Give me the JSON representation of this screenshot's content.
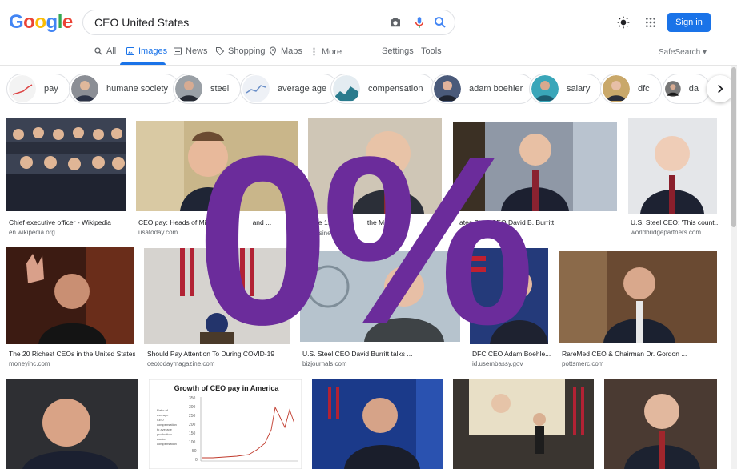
{
  "logo": "Google",
  "search": {
    "query": "CEO United States"
  },
  "tabs": [
    {
      "label": "All"
    },
    {
      "label": "Images"
    },
    {
      "label": "News"
    },
    {
      "label": "Shopping"
    },
    {
      "label": "Maps"
    },
    {
      "label": "More"
    }
  ],
  "tools": {
    "settings": "Settings",
    "tools": "Tools",
    "safesearch": "SafeSearch"
  },
  "header": {
    "signin": "Sign in"
  },
  "chips": [
    {
      "label": "pay"
    },
    {
      "label": "humane society"
    },
    {
      "label": "steel"
    },
    {
      "label": "average age"
    },
    {
      "label": "compensation"
    },
    {
      "label": "adam boehler"
    },
    {
      "label": "salary"
    },
    {
      "label": "dfc"
    },
    {
      "label": "da"
    }
  ],
  "results": [
    {
      "caption": "Chief executive officer - Wikipedia",
      "source": "en.wikipedia.org"
    },
    {
      "caption": "CEO pay: Heads of Mi",
      "caption2": "and ...",
      "source": "usatoday.com"
    },
    {
      "caption": "The 15 St",
      "caption2": "the Mo",
      "source": "businessinsi"
    },
    {
      "caption": "ates Steel CEO David B. Burritt",
      "source": "oneyinc.com"
    },
    {
      "caption": "U.S. Steel CEO: 'This count...",
      "source": "worldbridgepartners.com"
    },
    {
      "caption": "The 20 Richest CEOs in the United States",
      "source": "moneyinc.com"
    },
    {
      "caption": "Should Pay Attention To During COVID-19",
      "source": "ceotodaymagazine.com"
    },
    {
      "caption": "U.S. Steel CEO David Burritt talks ...",
      "source": "bizjournals.com"
    },
    {
      "caption": "DFC CEO Adam Boehle...",
      "source": "id.usembassy.gov"
    },
    {
      "caption": "RareMed CEO & Chairman Dr. Gordon ...",
      "source": "pottsmerc.com"
    }
  ],
  "chart_thumb": {
    "title": "Growth of CEO pay in America",
    "ylabel": "Ratio of average CEO compensation to average production worker compensation"
  },
  "overlay": {
    "text": "0%"
  },
  "colors": {
    "accent": "#1a73e8",
    "overlay": "#6b2c9b"
  }
}
